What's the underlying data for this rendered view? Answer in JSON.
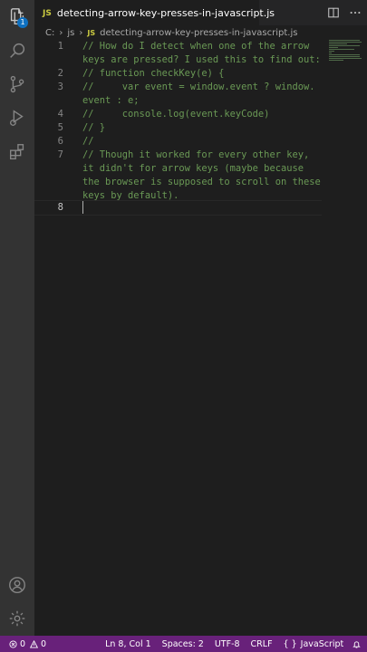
{
  "activity_bar": {
    "explorer_badge": "1",
    "items": [
      "files-icon",
      "search-icon",
      "source-control-icon",
      "run-debug-icon",
      "extensions-icon"
    ],
    "bottom_items": [
      "account-icon",
      "settings-gear-icon"
    ]
  },
  "tab": {
    "icon": "JS",
    "label": "detecting-arrow-key-presses-in-javascript.js",
    "dirty": true
  },
  "breadcrumb": {
    "root": "C:",
    "folder": "js",
    "file_icon": "JS",
    "file": "detecting-arrow-key-presses-in-javascript.js"
  },
  "editor": {
    "line_numbers": [
      "1",
      "2",
      "3",
      "4",
      "5",
      "6",
      "7",
      "8"
    ],
    "active_line": "8",
    "visual_lines": [
      "// How do I detect when one of the arrow",
      "keys are pressed? I used this to find out:",
      "// function checkKey(e) {",
      "//     var event = window.event ? window.",
      "event : e;",
      "//     console.log(event.keyCode)",
      "// }",
      "//",
      "// Though it worked for every other key,",
      "it didn't for arrow keys (maybe because",
      "the browser is supposed to scroll on these",
      "keys by default)."
    ]
  },
  "statusbar": {
    "errors": "0",
    "warnings": "0",
    "position": "Ln 8, Col 1",
    "spaces": "Spaces: 2",
    "encoding": "UTF-8",
    "eol": "CRLF",
    "language": "JavaScript",
    "language_icon": "{ }",
    "bg_color": "#68217a"
  },
  "colors": {
    "comment": "#6a9955",
    "editor_bg": "#1e1e1e",
    "activity_bar_bg": "#333333",
    "badge": "#0e70c0"
  }
}
